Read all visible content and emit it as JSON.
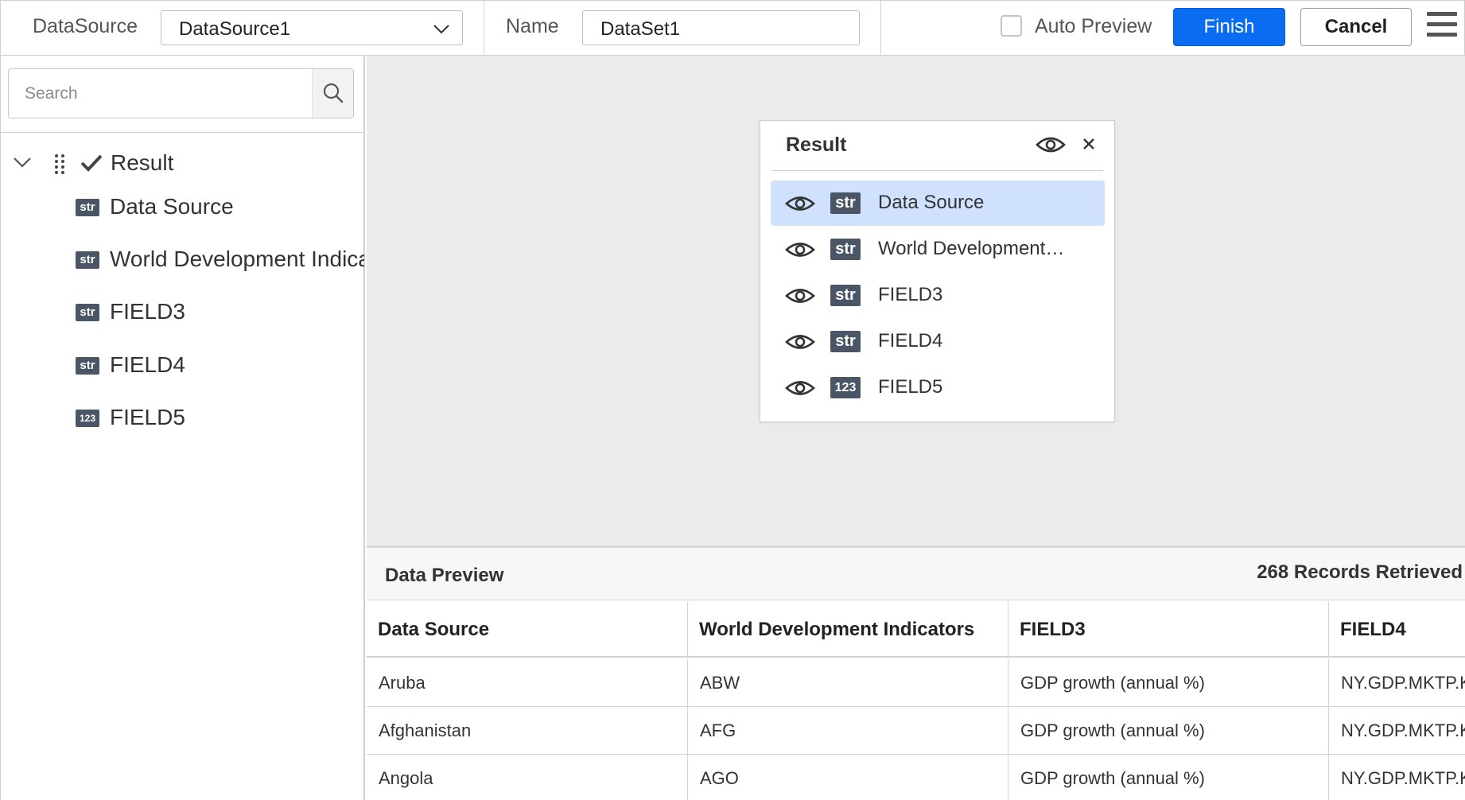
{
  "toolbar": {
    "datasource_label": "DataSource",
    "datasource_value": "DataSource1",
    "name_label": "Name",
    "name_value": "DataSet1",
    "auto_preview_label": "Auto Preview",
    "auto_preview_checked": false,
    "finish_label": "Finish",
    "cancel_label": "Cancel"
  },
  "left_panel": {
    "search_placeholder": "Search",
    "tree": {
      "root_label": "Result",
      "items": [
        {
          "type": "str",
          "label": "Data Source"
        },
        {
          "type": "str",
          "label": "World Development Indicators"
        },
        {
          "type": "str",
          "label": "FIELD3"
        },
        {
          "type": "str",
          "label": "FIELD4"
        },
        {
          "type": "123",
          "label": "FIELD5"
        }
      ]
    }
  },
  "result_card": {
    "title": "Result",
    "fields": [
      {
        "type": "str",
        "label": "Data Source",
        "selected": true
      },
      {
        "type": "str",
        "label": "World Development…",
        "selected": false
      },
      {
        "type": "str",
        "label": "FIELD3",
        "selected": false
      },
      {
        "type": "str",
        "label": "FIELD4",
        "selected": false
      },
      {
        "type": "123",
        "label": "FIELD5",
        "selected": false
      }
    ]
  },
  "preview": {
    "title": "Data Preview",
    "records": "268 Records Retrieved",
    "columns": [
      "Data Source",
      "World Development Indicators",
      "FIELD3",
      "FIELD4"
    ],
    "rows": [
      [
        "Aruba",
        "ABW",
        "GDP growth (annual %)",
        "NY.GDP.MKTP.KD.ZG"
      ],
      [
        "Afghanistan",
        "AFG",
        "GDP growth (annual %)",
        "NY.GDP.MKTP.KD.ZG"
      ],
      [
        "Angola",
        "AGO",
        "GDP growth (annual %)",
        "NY.GDP.MKTP.KD.ZG"
      ]
    ]
  },
  "colors": {
    "primary": "#0a6cf1",
    "selected_row": "#cfe1fd",
    "type_badge": "#4a5566",
    "canvas_bg": "#ebebeb"
  }
}
